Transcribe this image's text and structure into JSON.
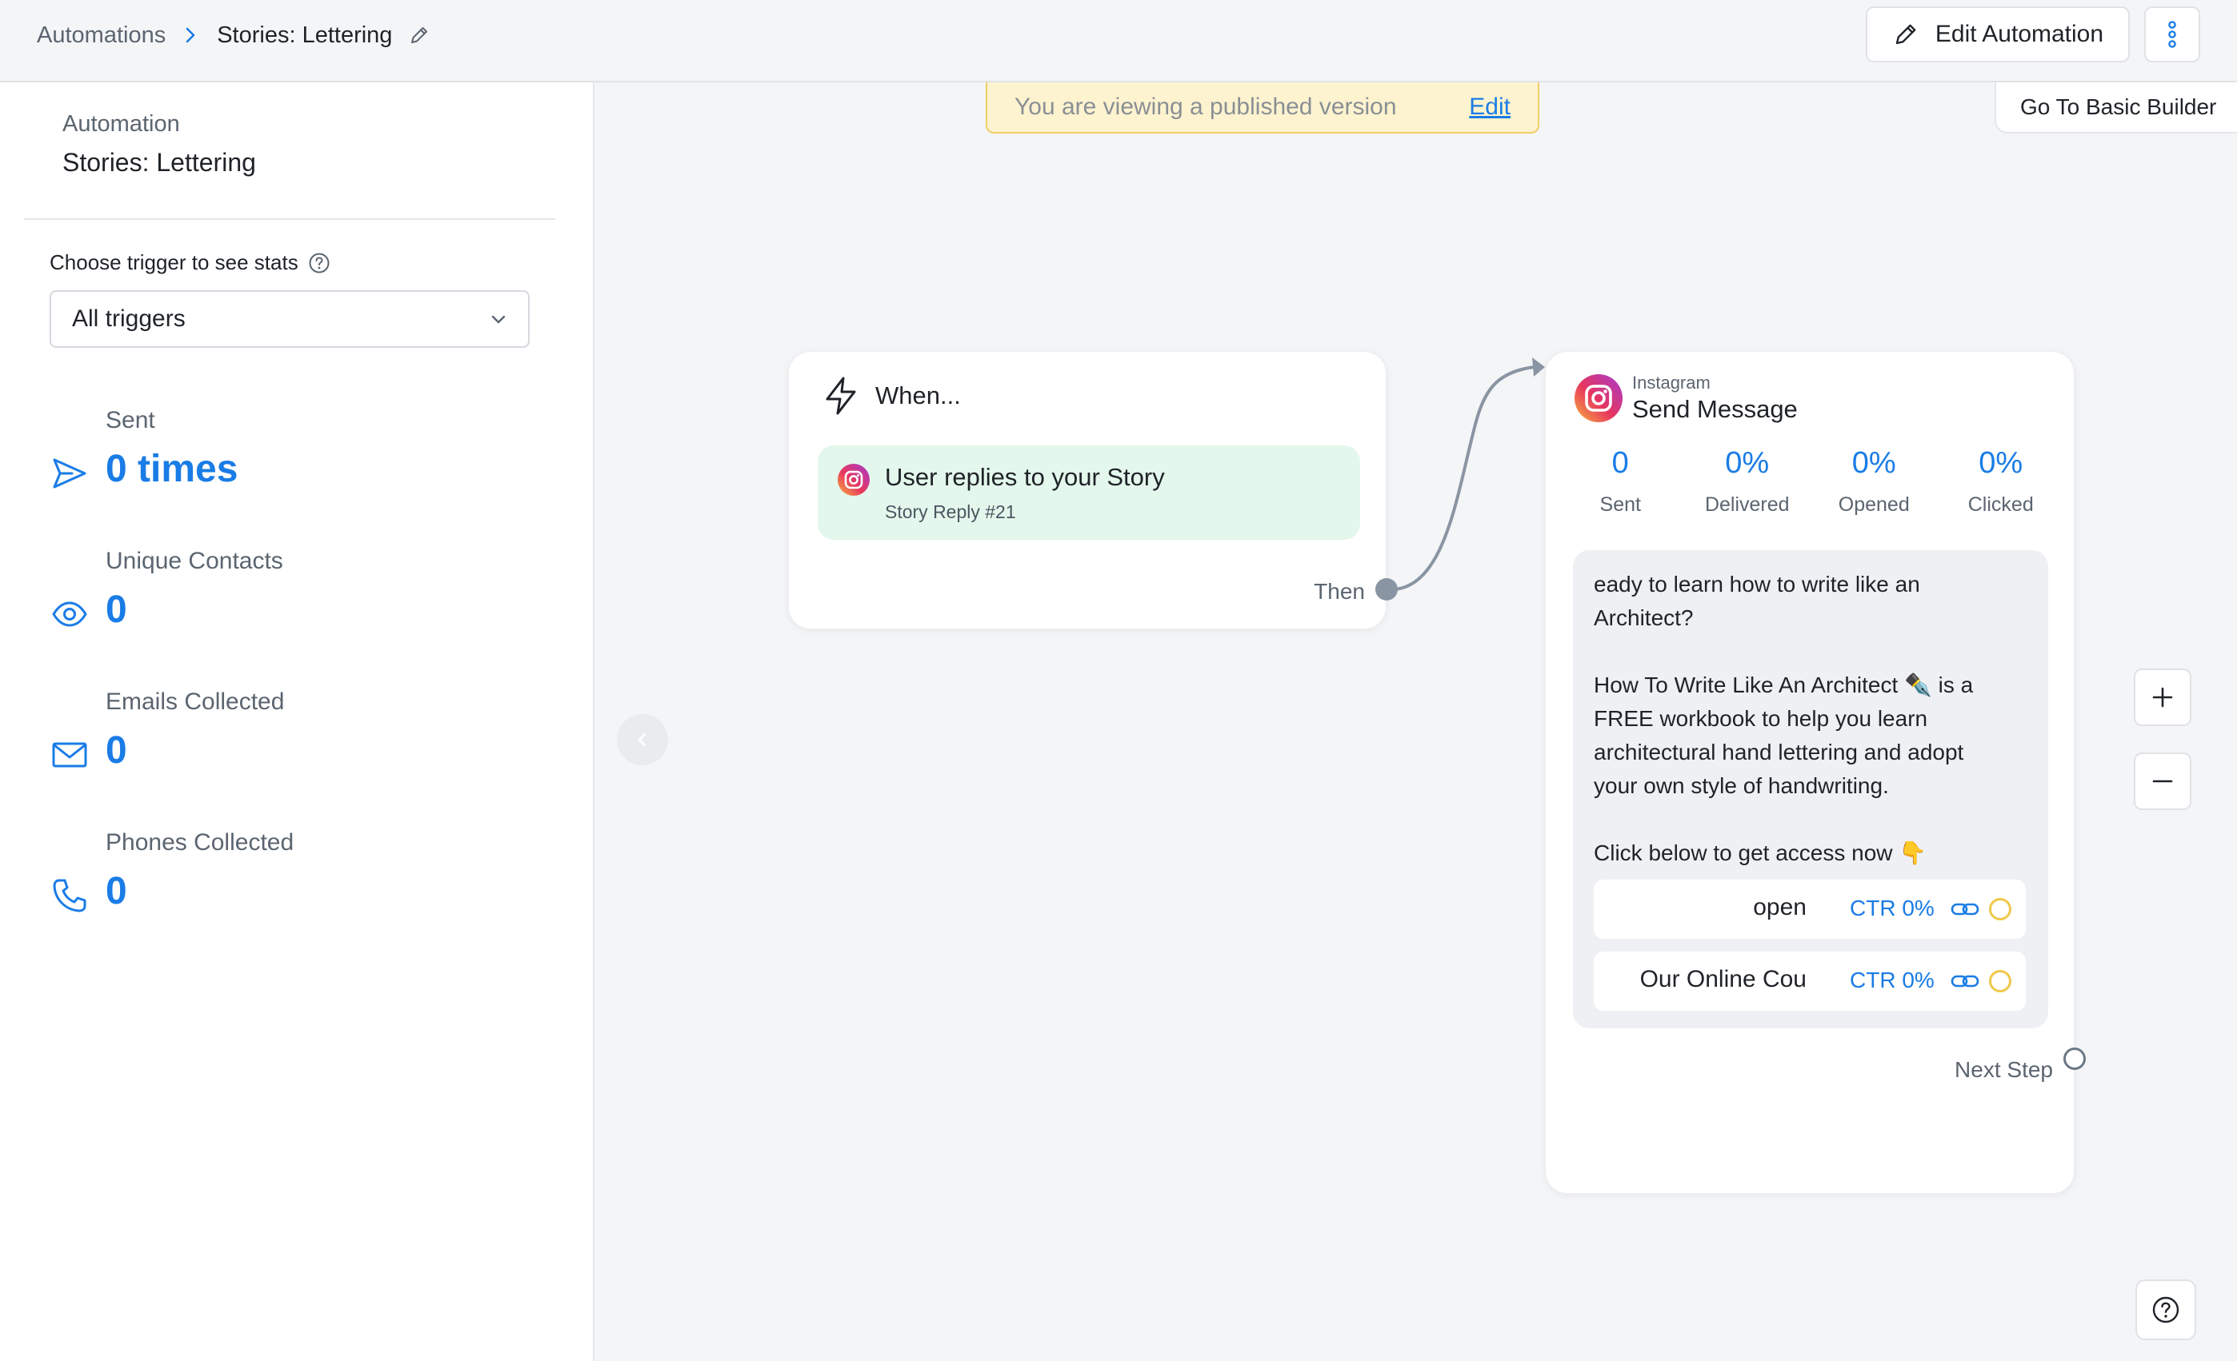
{
  "header": {
    "breadcrumb_root": "Automations",
    "breadcrumb_current": "Stories: Lettering",
    "edit_button_label": "Edit Automation"
  },
  "sidebar": {
    "section_label": "Automation",
    "automation_name": "Stories: Lettering",
    "trigger_select_label": "Choose trigger to see stats",
    "trigger_select_value": "All triggers",
    "stats": [
      {
        "label": "Sent",
        "value": "0 times",
        "icon": "send-icon"
      },
      {
        "label": "Unique Contacts",
        "value": "0",
        "icon": "eye-icon"
      },
      {
        "label": "Emails Collected",
        "value": "0",
        "icon": "mail-icon"
      },
      {
        "label": "Phones Collected",
        "value": "0",
        "icon": "phone-icon"
      }
    ]
  },
  "canvas": {
    "banner_text": "You are viewing a published version",
    "banner_link": "Edit",
    "basic_builder_label": "Go To Basic Builder",
    "trigger_node": {
      "heading": "When...",
      "trigger_title": "User replies to your Story",
      "trigger_subtitle": "Story Reply #21",
      "then_label": "Then"
    },
    "send_node": {
      "channel": "Instagram",
      "title": "Send Message",
      "stats": [
        {
          "value": "0",
          "label": "Sent"
        },
        {
          "value": "0%",
          "label": "Delivered"
        },
        {
          "value": "0%",
          "label": "Opened"
        },
        {
          "value": "0%",
          "label": "Clicked"
        }
      ],
      "message": "eady to learn how to write like an\nArchitect?\n\nHow To Write Like An Architect ✒️ is a\nFREE workbook to help you learn\narchitectural hand lettering and adopt\nyour own style of handwriting.\n\nClick below to get access now 👇",
      "buttons": [
        {
          "label": "open",
          "ctr": "CTR 0%"
        },
        {
          "label": "Our Online Cou",
          "ctr": "CTR 0%"
        }
      ],
      "next_step_label": "Next Step"
    }
  },
  "colors": {
    "accent": "#1a7ce6",
    "trigger_bg": "#e4f7ec",
    "banner_bg": "#fdf3cf",
    "banner_border": "#f1cf6b",
    "pending_dot": "#f0c84a"
  }
}
